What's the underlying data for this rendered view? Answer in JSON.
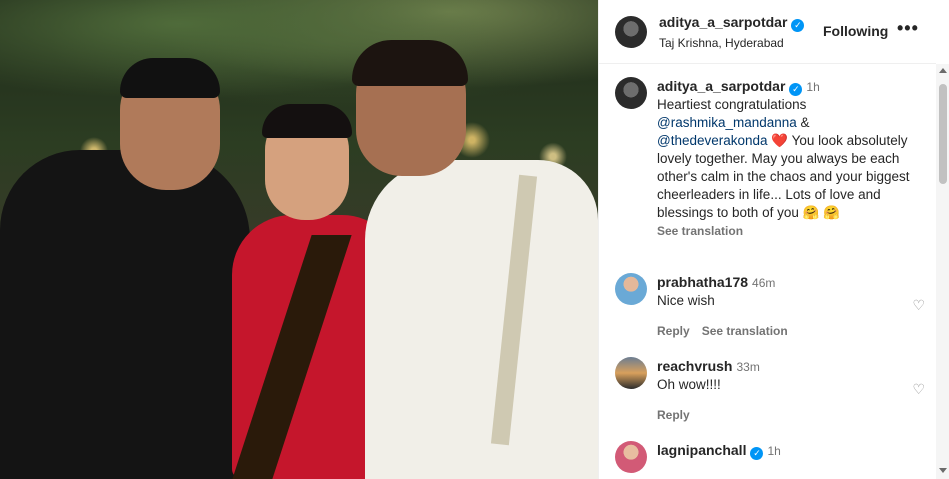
{
  "post": {
    "photo_alt": "post-photo",
    "header": {
      "username": "aditya_a_sarpotdar",
      "verified": true,
      "location": "Taj Krishna, Hyderabad",
      "follow_label": "Following",
      "more_label": "•••"
    }
  },
  "caption": {
    "username": "aditya_a_sarpotdar",
    "time": "1h",
    "text_line1": "Heartiest congratulations",
    "mention1": "@rashmika_mandanna",
    "amp": " &",
    "mention2": "@thedeverakonda",
    "heart": " ❤️ ",
    "text_rest": "You look absolutely lovely together. May you always be each other's calm in the chaos and your biggest cheerleaders in life... Lots of love and blessings to both of you 🤗 🤗",
    "see_translation": "See translation"
  },
  "comments": [
    {
      "username": "prabhatha178",
      "time": "46m",
      "text": "Nice wish",
      "reply": "Reply",
      "see_translation": "See translation"
    },
    {
      "username": "reachvrush",
      "time": "33m",
      "text": "Oh wow!!!!",
      "reply": "Reply"
    },
    {
      "username": "lagnipanchall",
      "verified": true,
      "time": "1h"
    }
  ],
  "icons": {
    "heart_outline": "♡",
    "verified_check": "✓"
  },
  "colors": {
    "verified_blue": "#0095f6",
    "mention": "#00376b",
    "secondary_text": "#737373"
  }
}
